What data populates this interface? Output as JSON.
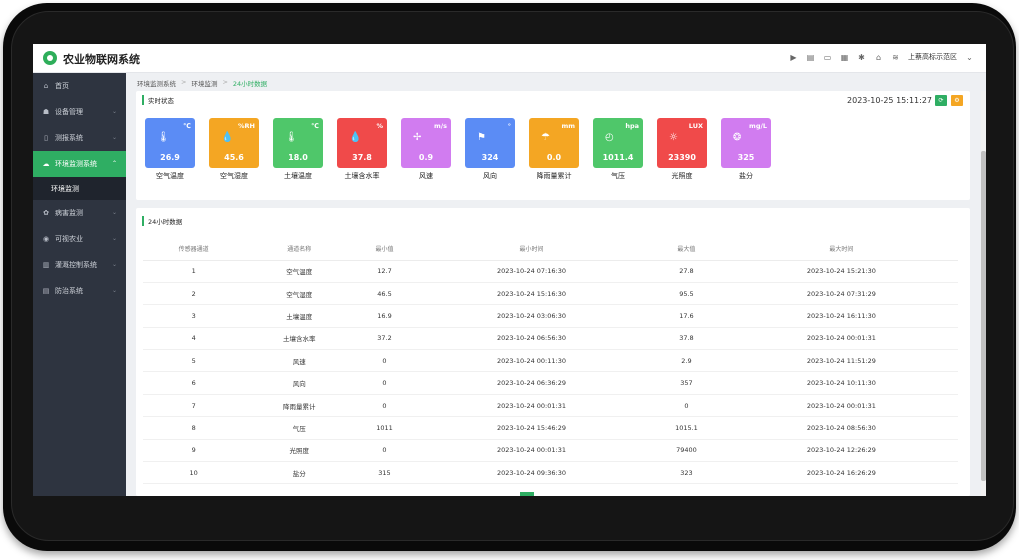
{
  "app": {
    "title": "农业物联网系统",
    "area": "上蔡高标示范区"
  },
  "topbar_icons": [
    "play-icon",
    "document-icon",
    "monitor-icon",
    "grid-icon",
    "gear-icon",
    "home-icon",
    "layers-icon"
  ],
  "sidebar": {
    "items": [
      {
        "label": "首页",
        "icon": "home-icon",
        "has_arrow": false
      },
      {
        "label": "设备管理",
        "icon": "users-icon",
        "has_arrow": true
      },
      {
        "label": "测报系统",
        "icon": "device-icon",
        "has_arrow": true
      },
      {
        "label": "环境监测系统",
        "icon": "cloud-icon",
        "has_arrow": true,
        "active": true,
        "expanded": true
      },
      {
        "label": "病害监测",
        "icon": "bug-icon",
        "has_arrow": true
      },
      {
        "label": "可视农业",
        "icon": "eye-icon",
        "has_arrow": true
      },
      {
        "label": "灌溉控制系统",
        "icon": "chart-icon",
        "has_arrow": true
      },
      {
        "label": "防治系统",
        "icon": "file-icon",
        "has_arrow": true
      }
    ],
    "sub_item": "环境监测"
  },
  "breadcrumb": [
    "环境监测系统",
    "环境监测",
    "24小时数据"
  ],
  "realtime": {
    "title": "实时状态",
    "datetime": "2023-10-25 15:11:27",
    "tiles": [
      {
        "label": "空气温度",
        "unit": "℃",
        "value": "26.9",
        "color": "#5b8cf5",
        "icon": "thermometer-icon"
      },
      {
        "label": "空气湿度",
        "unit": "%RH",
        "value": "45.6",
        "color": "#f4a623",
        "icon": "droplet-icon"
      },
      {
        "label": "土壤温度",
        "unit": "℃",
        "value": "18.0",
        "color": "#4fc76a",
        "icon": "thermometer-icon"
      },
      {
        "label": "土壤含水率",
        "unit": "%",
        "value": "37.8",
        "color": "#f04a4a",
        "icon": "droplet-icon"
      },
      {
        "label": "风速",
        "unit": "m/s",
        "value": "0.9",
        "color": "#d17cf0",
        "icon": "fan-icon"
      },
      {
        "label": "风向",
        "unit": "°",
        "value": "324",
        "color": "#5b8cf5",
        "icon": "flag-icon"
      },
      {
        "label": "降雨量累计",
        "unit": "mm",
        "value": "0.0",
        "color": "#f4a623",
        "icon": "rain-icon"
      },
      {
        "label": "气压",
        "unit": "hpa",
        "value": "1011.4",
        "color": "#4fc76a",
        "icon": "gauge-icon"
      },
      {
        "label": "光照度",
        "unit": "LUX",
        "value": "23390",
        "color": "#f04a4a",
        "icon": "sun-icon"
      },
      {
        "label": "盐分",
        "unit": "mg/L",
        "value": "325",
        "color": "#d17cf0",
        "icon": "salt-icon"
      }
    ]
  },
  "table24": {
    "title": "24小时数据",
    "headers": [
      "传感器通道",
      "通道名称",
      "最小值",
      "最小时间",
      "最大值",
      "最大时间"
    ],
    "rows": [
      [
        "1",
        "空气温度",
        "12.7",
        "2023-10-24 07:16:30",
        "27.8",
        "2023-10-24 15:21:30"
      ],
      [
        "2",
        "空气湿度",
        "46.5",
        "2023-10-24 15:16:30",
        "95.5",
        "2023-10-24 07:31:29"
      ],
      [
        "3",
        "土壤温度",
        "16.9",
        "2023-10-24 03:06:30",
        "17.6",
        "2023-10-24 16:11:30"
      ],
      [
        "4",
        "土壤含水率",
        "37.2",
        "2023-10-24 06:56:30",
        "37.8",
        "2023-10-24 00:01:31"
      ],
      [
        "5",
        "风速",
        "0",
        "2023-10-24 00:11:30",
        "2.9",
        "2023-10-24 11:51:29"
      ],
      [
        "6",
        "风向",
        "0",
        "2023-10-24 06:36:29",
        "357",
        "2023-10-24 10:11:30"
      ],
      [
        "7",
        "降雨量累计",
        "0",
        "2023-10-24 00:01:31",
        "0",
        "2023-10-24 00:01:31"
      ],
      [
        "8",
        "气压",
        "1011",
        "2023-10-24 15:46:29",
        "1015.1",
        "2023-10-24 08:56:30"
      ],
      [
        "9",
        "光照度",
        "0",
        "2023-10-24 00:01:31",
        "79400",
        "2023-10-24 12:26:29"
      ],
      [
        "10",
        "盐分",
        "315",
        "2023-10-24 09:36:30",
        "323",
        "2023-10-24 16:26:29"
      ]
    ]
  }
}
